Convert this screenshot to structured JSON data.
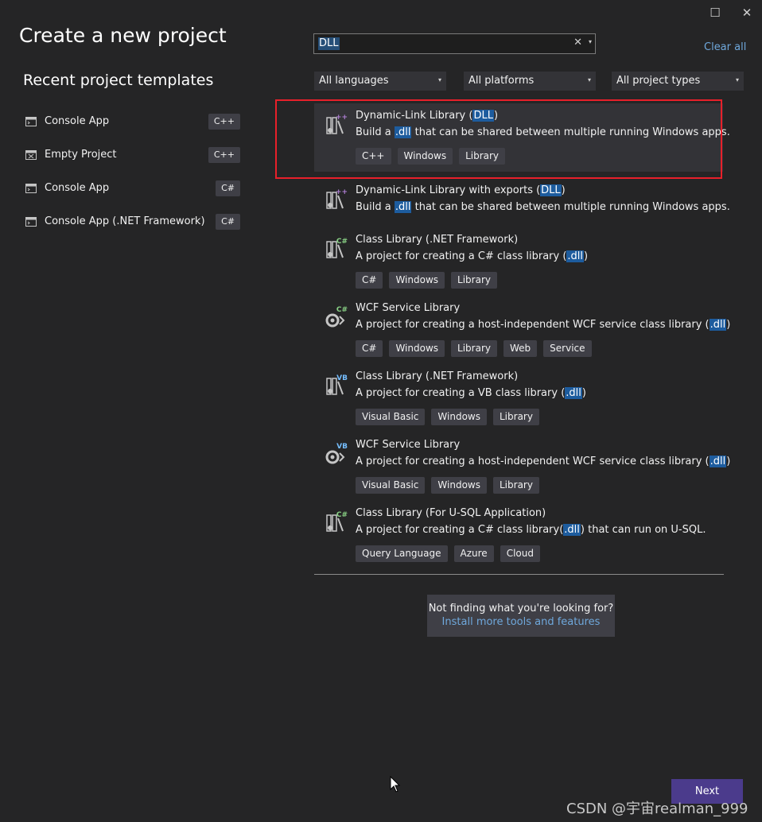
{
  "window": {
    "maximize_glyph": "☐",
    "close_glyph": "✕"
  },
  "page_title": "Create a new project",
  "recent": {
    "title": "Recent project templates",
    "items": [
      {
        "label": "Console App",
        "lang": "C++",
        "icon": "console-app-icon"
      },
      {
        "label": "Empty Project",
        "lang": "C++",
        "icon": "empty-project-icon"
      },
      {
        "label": "Console App",
        "lang": "C#",
        "icon": "console-app-icon"
      },
      {
        "label": "Console App (.NET Framework)",
        "lang": "C#",
        "icon": "console-app-icon"
      }
    ]
  },
  "search": {
    "value": "DLL",
    "clear_glyph": "✕",
    "dropdown_glyph": "▾"
  },
  "clear_all": "Clear all",
  "filters": {
    "language": "All languages",
    "platform": "All platforms",
    "project_type": "All project types",
    "chevron": "▾"
  },
  "templates": [
    {
      "name_pre": "Dynamic-Link Library (",
      "name_hl": "DLL",
      "name_post": ")",
      "desc_pre": "Build a ",
      "desc_hl": ".dll",
      "desc_post": " that can be shared between multiple running Windows apps.",
      "tags": [
        "C++",
        "Windows",
        "Library"
      ],
      "badge": "++",
      "badge_color": "#b180d7",
      "icon": "dll-cpp-icon"
    },
    {
      "name_pre": "Dynamic-Link Library with exports (",
      "name_hl": "DLL",
      "name_post": ")",
      "desc_pre": "Build a ",
      "desc_hl": ".dll",
      "desc_post": " that can be shared between multiple running Windows apps.",
      "tags": [],
      "badge": "++",
      "badge_color": "#b180d7",
      "icon": "dll-cpp-exports-icon"
    },
    {
      "name_pre": "Class Library (.NET Framework)",
      "name_hl": "",
      "name_post": "",
      "desc_pre": "A project for creating a C# class library (",
      "desc_hl": ".dll",
      "desc_post": ")",
      "tags": [
        "C#",
        "Windows",
        "Library"
      ],
      "badge": "C#",
      "badge_color": "#89d185",
      "icon": "class-library-csharp-icon"
    },
    {
      "name_pre": "WCF Service Library",
      "name_hl": "",
      "name_post": "",
      "desc_pre": "A project for creating a host-independent WCF service class library (",
      "desc_hl": ".dll",
      "desc_post": ")",
      "tags": [
        "C#",
        "Windows",
        "Library",
        "Web",
        "Service"
      ],
      "badge": "C#",
      "badge_color": "#89d185",
      "icon": "wcf-service-csharp-icon"
    },
    {
      "name_pre": "Class Library (.NET Framework)",
      "name_hl": "",
      "name_post": "",
      "desc_pre": "A project for creating a VB class library (",
      "desc_hl": ".dll",
      "desc_post": ")",
      "tags": [
        "Visual Basic",
        "Windows",
        "Library"
      ],
      "badge": "VB",
      "badge_color": "#75beff",
      "icon": "class-library-vb-icon"
    },
    {
      "name_pre": "WCF Service Library",
      "name_hl": "",
      "name_post": "",
      "desc_pre": "A project for creating a host-independent WCF service class library (",
      "desc_hl": ".dll",
      "desc_post": ")",
      "tags": [
        "Visual Basic",
        "Windows",
        "Library"
      ],
      "badge": "VB",
      "badge_color": "#75beff",
      "icon": "wcf-service-vb-icon"
    },
    {
      "name_pre": "Class Library (For U-SQL Application)",
      "name_hl": "",
      "name_post": "",
      "desc_pre": "A project for creating a C# class library(",
      "desc_hl": ".dll",
      "desc_post": ") that can run on U-SQL.",
      "tags": [
        "Query Language",
        "Azure",
        "Cloud"
      ],
      "badge": "C#",
      "badge_color": "#89d185",
      "icon": "class-library-usql-icon"
    }
  ],
  "not_finding": {
    "question": "Not finding what you're looking for?",
    "link": "Install more tools and features"
  },
  "next_button": "Next",
  "watermark": "CSDN @宇宙realman_999",
  "colors": {
    "background": "#252526",
    "accent_link": "#6fa8dc",
    "selection_highlight": "#1d5c9e",
    "next_button": "#4b3b8c",
    "annotation_box": "#e8202a"
  }
}
